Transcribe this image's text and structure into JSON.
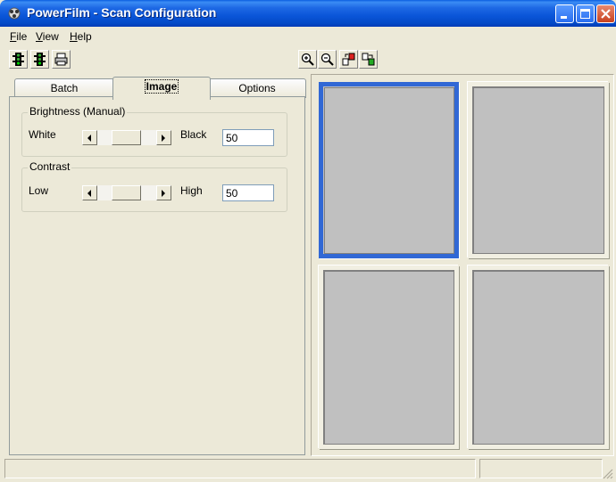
{
  "window": {
    "title": "PowerFilm - Scan Configuration",
    "controls": [
      "minimize",
      "maximize",
      "close"
    ]
  },
  "menu": {
    "items": [
      {
        "label": "File"
      },
      {
        "label": "View"
      },
      {
        "label": "Help"
      }
    ]
  },
  "toolbar": {
    "left_icons": [
      "traffic-light-icon",
      "traffic-light-icon",
      "print-icon"
    ],
    "right_icons": [
      "zoom-in-icon",
      "zoom-out-icon",
      "swap-frames-icon",
      "arrange-frames-icon"
    ]
  },
  "tabs": [
    {
      "label": "Batch",
      "active": false
    },
    {
      "label": "Image",
      "active": true
    },
    {
      "label": "Options",
      "active": false
    }
  ],
  "brightness": {
    "group_label": "Brightness (Manual)",
    "left_label": "White",
    "right_label": "Black",
    "value": "50"
  },
  "contrast": {
    "group_label": "Contrast",
    "left_label": "Low",
    "right_label": "High",
    "value": "50"
  },
  "preview": {
    "frames": [
      {
        "selected": true
      },
      {
        "selected": false
      },
      {
        "selected": false
      },
      {
        "selected": false
      }
    ]
  },
  "status": {
    "panes": [
      "",
      ""
    ]
  },
  "colors": {
    "titlebar": "#0a55d8",
    "selection": "#3168d5",
    "frame_fill": "#c0c0c0",
    "window_bg": "#ece9d8"
  }
}
